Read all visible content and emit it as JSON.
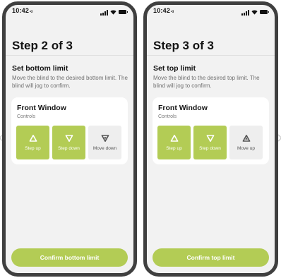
{
  "screens": [
    {
      "status": {
        "time": "10:42",
        "location_glyph": "◃"
      },
      "title": "Step 2 of 3",
      "subtitle": "Set bottom limit",
      "description": "Move the blind to the desired bottom limit. The blind will jog to confirm.",
      "device": {
        "name": "Front Window",
        "type": "Controls"
      },
      "controls": [
        {
          "label": "Step up",
          "icon": "triangle-up-icon",
          "style": "active"
        },
        {
          "label": "Step down",
          "icon": "triangle-down-icon",
          "style": "active"
        },
        {
          "label": "Move down",
          "icon": "triangle-down-icon",
          "style": "neutral"
        }
      ],
      "confirm_label": "Confirm bottom limit"
    },
    {
      "status": {
        "time": "10:42",
        "location_glyph": "◃"
      },
      "title": "Step 3 of 3",
      "subtitle": "Set top limit",
      "description": "Move the blind to the desired top limit. The blind will jog to confirm.",
      "device": {
        "name": "Front Window",
        "type": "Controls"
      },
      "controls": [
        {
          "label": "Step up",
          "icon": "triangle-up-icon",
          "style": "active"
        },
        {
          "label": "Step down",
          "icon": "triangle-down-icon",
          "style": "active"
        },
        {
          "label": "Move up",
          "icon": "triangle-up-icon",
          "style": "neutral"
        }
      ],
      "confirm_label": "Confirm top limit"
    }
  ],
  "colors": {
    "accent": "#b3cc55",
    "frame": "#3f3f3f",
    "background": "#f2f2f2"
  }
}
